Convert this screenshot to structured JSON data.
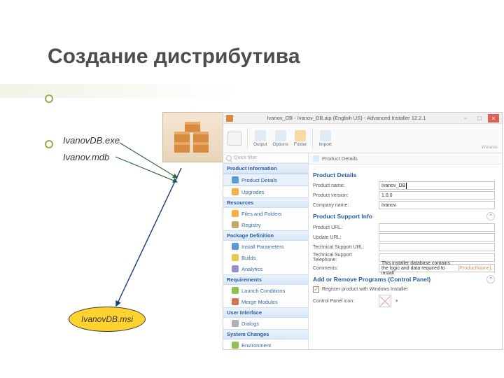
{
  "slide": {
    "title": "Создание дистрибутива",
    "file_exe": "IvanovDB.exe",
    "file_mdb": "Ivanov.mdb",
    "file_msi": "IvanovDB.msi"
  },
  "window": {
    "title": "Ivanov_DB - Ivanov_DB.aip (English US) - Advanced Installer 12.2.1",
    "ribbon": {
      "output": "Output",
      "options": "Options",
      "folder": "Folder",
      "import": "Import",
      "wizards": "Wizards"
    },
    "quick_filter": "Quick filter",
    "sections": {
      "product_info": "Product Information",
      "product_details": "Product Details",
      "upgrades": "Upgrades",
      "resources": "Resources",
      "files_folders": "Files and Folders",
      "registry": "Registry",
      "pkg_def": "Package Definition",
      "install_params": "Install Parameters",
      "builds": "Builds",
      "analytics": "Analytics",
      "requirements": "Requirements",
      "launch_cond": "Launch Conditions",
      "merge_modules": "Merge Modules",
      "ui": "User Interface",
      "dialogs": "Dialogs",
      "sys_changes": "System Changes",
      "environment": "Environment"
    },
    "breadcrumb": "Product Details",
    "form": {
      "section1": "Product Details",
      "product_name_label": "Product name:",
      "product_name": "Ivanov_DB",
      "product_version_label": "Product version:",
      "product_version": "1.0.0",
      "company_label": "Company name:",
      "company": "Ivanov",
      "section2": "Product Support Info",
      "product_url_label": "Product URL:",
      "update_url_label": "Update URL:",
      "support_url_label": "Technical Support URL:",
      "support_tel_label": "Technical Support Telephone:",
      "comments_label": "Comments:",
      "comments_pre": "This installer database contains the logic and data required to install ",
      "comments_ph": "[ProductName]",
      "comments_post": ".",
      "section3": "Add or Remove Programs (Control Panel)",
      "register_label": "Register product with Windows Installer",
      "cpl_icon_label": "Control Panel icon:"
    }
  }
}
